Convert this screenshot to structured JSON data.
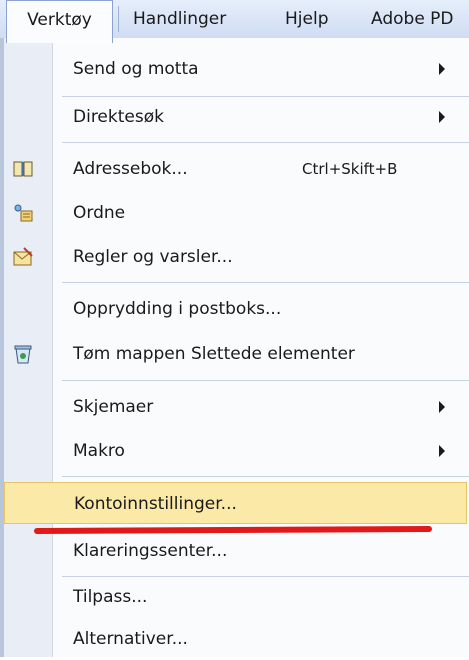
{
  "menubar": {
    "items": [
      "Verktøy",
      "Handlinger",
      "Hjelp",
      "Adobe PD"
    ]
  },
  "menu": {
    "items": [
      {
        "label": "Send og motta",
        "submenu": true
      },
      {
        "label": "Direktesøk",
        "submenu": true
      },
      {
        "label": "Adressebok...",
        "shortcut": "Ctrl+Skift+B",
        "icon": "address-book-icon"
      },
      {
        "label": "Ordne",
        "icon": "organize-icon"
      },
      {
        "label": "Regler og varsler...",
        "icon": "rules-alerts-icon"
      },
      {
        "label": "Opprydding i postboks..."
      },
      {
        "label": "Tøm mappen Slettede elementer",
        "icon": "empty-trash-icon"
      },
      {
        "label": "Skjemaer",
        "submenu": true
      },
      {
        "label": "Makro",
        "submenu": true
      },
      {
        "label": "Kontoinnstillinger...",
        "highlighted": true
      },
      {
        "label": "Klareringssenter..."
      },
      {
        "label": "Tilpass..."
      },
      {
        "label": "Alternativer..."
      }
    ]
  },
  "colors": {
    "highlight": "#fbe9a8",
    "annotation_underline": "#e11919"
  }
}
